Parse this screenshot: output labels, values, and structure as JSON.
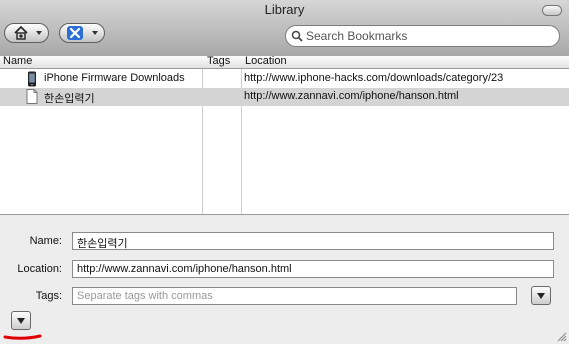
{
  "window": {
    "title": "Library"
  },
  "toolbar": {
    "organize_icon": "house-gear-icon",
    "view_icon": "sparkle-icon",
    "search_placeholder": "Search Bookmarks"
  },
  "table": {
    "columns": [
      "Name",
      "Tags",
      "Location"
    ],
    "rows": [
      {
        "icon": "iphone-icon",
        "name": "iPhone Firmware Downloads",
        "tags": "",
        "location": "http://www.iphone-hacks.com/downloads/category/23",
        "selected": false
      },
      {
        "icon": "page-icon",
        "name": "한손입력기",
        "tags": "",
        "location": "http://www.zannavi.com/iphone/hanson.html",
        "selected": true
      }
    ]
  },
  "details": {
    "name_label": "Name:",
    "name_value": "한손입력기",
    "location_label": "Location:",
    "location_value": "http://www.zannavi.com/iphone/hanson.html",
    "tags_label": "Tags:",
    "tags_placeholder": "Separate tags with commas"
  },
  "colors": {
    "selection": "#d4d4d4",
    "annotation": "#e00000"
  }
}
